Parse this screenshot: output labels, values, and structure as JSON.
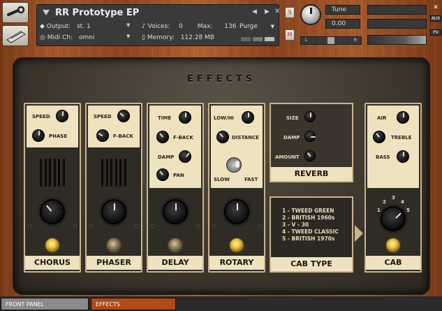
{
  "header": {
    "instrument_name": "RR Prototype EP",
    "output_label": "Output:",
    "output_value": "st. 1",
    "voices_label": "Voices:",
    "voices_value": "0",
    "max_label": "Max:",
    "max_value": "136",
    "purge_label": "Purge",
    "midi_label": "Midi Ch:",
    "midi_value": "omni",
    "memory_label": "Memory:",
    "memory_value": "112.28 MB",
    "solo_label": "S",
    "mute_label": "M",
    "tune_label": "Tune",
    "tune_value": "0.00",
    "pan_left": "L",
    "pan_right": "R",
    "aux_label": "AUX",
    "pv_label": "PV"
  },
  "effects": {
    "title": "EFFECTS",
    "chorus": {
      "name": "CHORUS",
      "speed": "SPEED",
      "phase": "PHASE"
    },
    "phaser": {
      "name": "PHASER",
      "speed": "SPEED",
      "fback": "F-BACK"
    },
    "delay": {
      "name": "DELAY",
      "time": "TIME",
      "fback": "F-BACK",
      "damp": "DAMP",
      "pan": "PAN"
    },
    "rotary": {
      "name": "ROTARY",
      "lowhi": "LOW/HI",
      "distance": "DISTANCE",
      "slow": "SLOW",
      "fast": "FAST"
    },
    "reverb": {
      "name": "REVERB",
      "size": "SIZE",
      "damp": "DAMP",
      "amount": "AMOUNT"
    },
    "cab_type": {
      "name": "CAB TYPE",
      "items": [
        "1 - TWEED GREEN",
        "2 - BRITISH 1960s",
        "3 - V - 30",
        "4 - TWEED CLASSIC",
        "5 - BRITISH 1970s"
      ]
    },
    "cab": {
      "name": "CAB",
      "air": "AIR",
      "treble": "TREBLE",
      "bass": "BASS",
      "positions": [
        "1",
        "2",
        "3",
        "4",
        "5"
      ]
    }
  },
  "tabs": [
    "FRONT PANEL",
    "EFFECTS"
  ],
  "colors": {
    "accent_tab": "#b04a16",
    "panel_cream": "#efe2bf",
    "lamp_on": "#f0c23a"
  }
}
